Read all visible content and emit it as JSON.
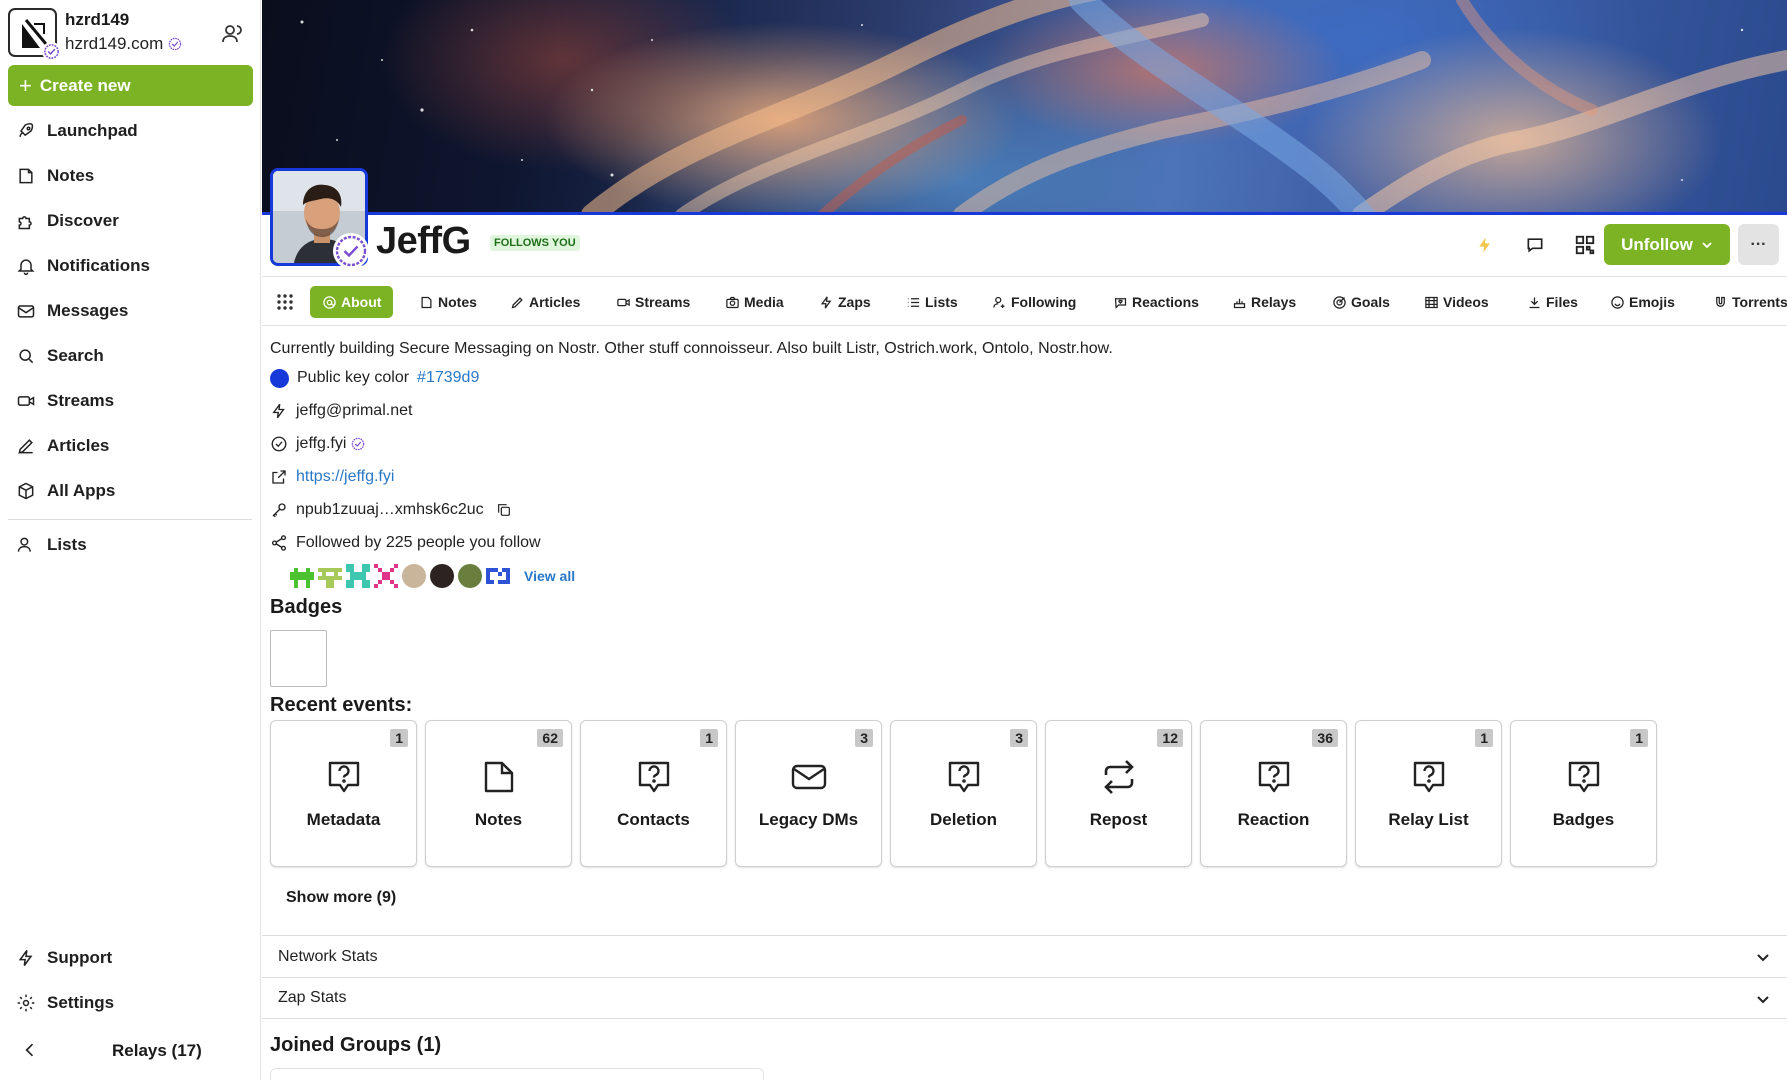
{
  "account": {
    "username": "hzrd149",
    "domain": "hzrd149.com"
  },
  "sidebar": {
    "create_label": "Create new",
    "items": [
      {
        "label": "Launchpad",
        "icon": "rocket-icon"
      },
      {
        "label": "Notes",
        "icon": "note-icon"
      },
      {
        "label": "Discover",
        "icon": "puzzle-icon"
      },
      {
        "label": "Notifications",
        "icon": "bell-icon"
      },
      {
        "label": "Messages",
        "icon": "mail-icon"
      },
      {
        "label": "Search",
        "icon": "search-icon"
      },
      {
        "label": "Streams",
        "icon": "video-icon"
      },
      {
        "label": "Articles",
        "icon": "pen-icon"
      },
      {
        "label": "All Apps",
        "icon": "box-icon"
      },
      {
        "label": "Lists",
        "icon": "users-icon"
      }
    ],
    "bottom": [
      {
        "label": "Support",
        "icon": "lightning-icon"
      },
      {
        "label": "Settings",
        "icon": "gear-icon"
      }
    ],
    "relays_label": "Relays (17)"
  },
  "profile": {
    "name": "JeffG",
    "follows_you": "FOLLOWS YOU",
    "unfollow_label": "Unfollow",
    "more_label": "···"
  },
  "tabs": [
    {
      "label": "About",
      "icon": "at-icon",
      "active": true
    },
    {
      "label": "Notes",
      "icon": "note-icon"
    },
    {
      "label": "Articles",
      "icon": "pen-icon"
    },
    {
      "label": "Streams",
      "icon": "video-icon"
    },
    {
      "label": "Media",
      "icon": "camera-icon"
    },
    {
      "label": "Zaps",
      "icon": "lightning-icon"
    },
    {
      "label": "Lists",
      "icon": "list-icon"
    },
    {
      "label": "Following",
      "icon": "user-plus-icon"
    },
    {
      "label": "Reactions",
      "icon": "heart-icon"
    },
    {
      "label": "Relays",
      "icon": "relay-icon"
    },
    {
      "label": "Goals",
      "icon": "target-icon"
    },
    {
      "label": "Videos",
      "icon": "film-icon"
    },
    {
      "label": "Files",
      "icon": "download-icon"
    },
    {
      "label": "Emojis",
      "icon": "smile-icon"
    },
    {
      "label": "Torrents",
      "icon": "magnet-icon"
    }
  ],
  "about": {
    "bio": "Currently building Secure Messaging on Nostr. Other stuff connoisseur. Also built Listr, Ostrich.work, Ontolo, Nostr.how.",
    "pubkey_color_label": "Public key color",
    "pubkey_color": "#1739d9",
    "lightning": "jeffg@primal.net",
    "nip05": "jeffg.fyi",
    "website": "https://jeffg.fyi",
    "npub": "npub1zuuaj…xmhsk6c2uc",
    "followed_by": "Followed by 225 people you follow",
    "view_all": "View all"
  },
  "badges_heading": "Badges",
  "recent_heading": "Recent events:",
  "events": [
    {
      "label": "Metadata",
      "count": "1",
      "icon": "question-bubble-icon"
    },
    {
      "label": "Notes",
      "count": "62",
      "icon": "note-icon"
    },
    {
      "label": "Contacts",
      "count": "1",
      "icon": "question-bubble-icon"
    },
    {
      "label": "Legacy DMs",
      "count": "3",
      "icon": "mail-icon"
    },
    {
      "label": "Deletion",
      "count": "3",
      "icon": "question-bubble-icon"
    },
    {
      "label": "Repost",
      "count": "12",
      "icon": "repost-icon"
    },
    {
      "label": "Reaction",
      "count": "36",
      "icon": "question-bubble-icon"
    },
    {
      "label": "Relay List",
      "count": "1",
      "icon": "question-bubble-icon"
    },
    {
      "label": "Badges",
      "count": "1",
      "icon": "question-bubble-icon"
    }
  ],
  "show_more": "Show more (9)",
  "network_stats": "Network Stats",
  "zap_stats": "Zap Stats",
  "joined_groups": "Joined Groups (1)",
  "colors": {
    "accent": "#7cb324",
    "pubkey": "#1739d9",
    "link": "#2a78c8"
  }
}
